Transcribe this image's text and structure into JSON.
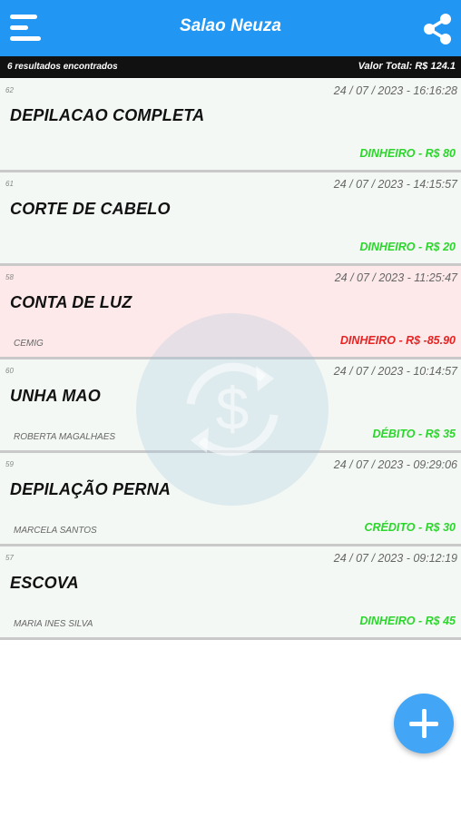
{
  "appbar": {
    "title": "Salao Neuza",
    "menu_icon": "hamburger-menu-icon",
    "share_icon": "share-icon",
    "color": "#2196f3"
  },
  "summary": {
    "results_text": "6 resultados encontrados",
    "total_text": "Valor Total: R$ 124.1"
  },
  "items": [
    {
      "id": "62",
      "datetime": "24 / 07 / 2023 - 16:16:28",
      "name": "DEPILACAO COMPLETA",
      "client": "",
      "amount": "DINHEIRO - R$ 80",
      "type": "income"
    },
    {
      "id": "61",
      "datetime": "24 / 07 / 2023 - 14:15:57",
      "name": "CORTE DE CABELO",
      "client": "",
      "amount": "DINHEIRO - R$ 20",
      "type": "income"
    },
    {
      "id": "58",
      "datetime": "24 / 07 / 2023 - 11:25:47",
      "name": "CONTA DE LUZ",
      "client": "CEMIG",
      "amount": "DINHEIRO - R$ -85.90",
      "type": "expense"
    },
    {
      "id": "60",
      "datetime": "24 / 07 / 2023 - 10:14:57",
      "name": "UNHA MAO",
      "client": "ROBERTA MAGALHAES",
      "amount": "DÉBITO - R$ 35",
      "type": "income"
    },
    {
      "id": "59",
      "datetime": "24 / 07 / 2023 - 09:29:06",
      "name": "DEPILAÇÃO PERNA",
      "client": "MARCELA SANTOS",
      "amount": "CRÉDITO - R$ 30",
      "type": "income"
    },
    {
      "id": "57",
      "datetime": "24 / 07 / 2023 - 09:12:19",
      "name": "ESCOVA",
      "client": "MARIA INES SILVA",
      "amount": "DINHEIRO - R$ 45",
      "type": "income"
    }
  ],
  "colors": {
    "income_amount": "#2bd62b",
    "expense_amount": "#e82323",
    "income_bg": "#f3f8f4",
    "expense_bg": "#fde9ea",
    "fab": "#42a5f5"
  },
  "fab": {
    "icon": "plus-icon"
  },
  "watermark": {
    "icon": "dollar-refresh-icon"
  }
}
